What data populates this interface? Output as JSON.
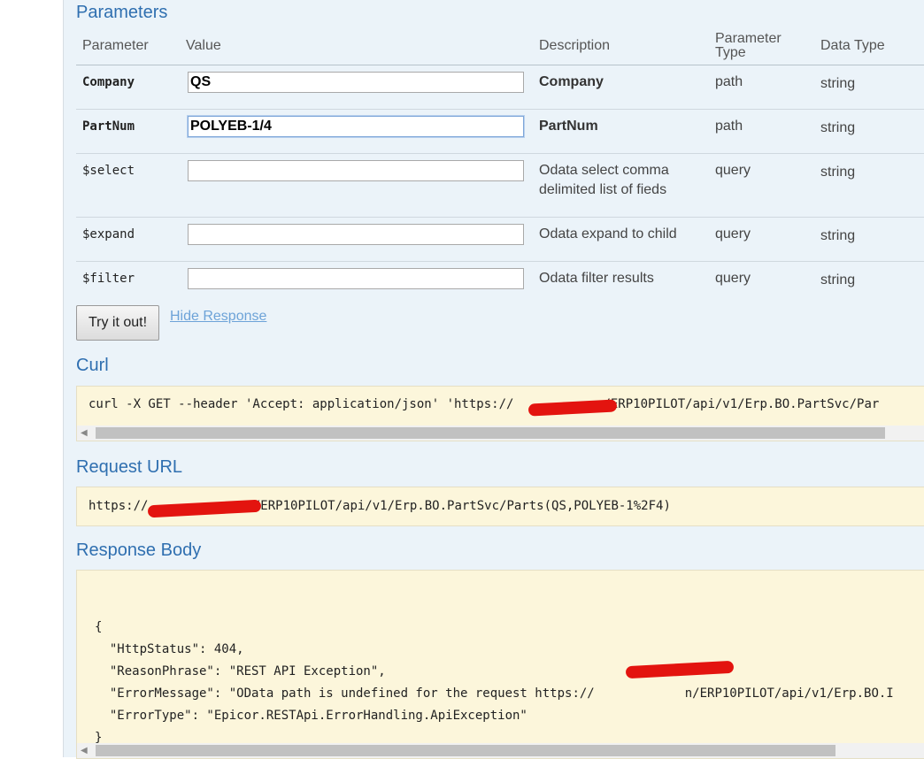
{
  "parameters": {
    "title": "Parameters",
    "headers": {
      "parameter": "Parameter",
      "value": "Value",
      "description": "Description",
      "parameter_type": "Parameter Type",
      "data_type": "Data Type"
    },
    "rows": [
      {
        "name": "Company",
        "value": "QS",
        "description": "Company",
        "param_type": "path",
        "data_type": "string"
      },
      {
        "name": "PartNum",
        "value": "POLYEB-1/4",
        "description": "PartNum",
        "param_type": "path",
        "data_type": "string"
      },
      {
        "name": "$select",
        "value": "",
        "description": "Odata select comma delimited list of fieds",
        "param_type": "query",
        "data_type": "string"
      },
      {
        "name": "$expand",
        "value": "",
        "description": "Odata expand to child",
        "param_type": "query",
        "data_type": "string"
      },
      {
        "name": "$filter",
        "value": "",
        "description": "Odata filter results",
        "param_type": "query",
        "data_type": "string"
      }
    ]
  },
  "actions": {
    "try_label": "Try it out!",
    "hide_response_label": "Hide Response"
  },
  "curl": {
    "title": "Curl",
    "text_before": "curl -X GET --header 'Accept: application/json' 'https://",
    "text_after": "/ERP10PILOT/api/v1/Erp.BO.PartSvc/Par"
  },
  "request_url": {
    "title": "Request URL",
    "text_before": "https://",
    "text_after": "n/ERP10PILOT/api/v1/Erp.BO.PartSvc/Parts(QS,POLYEB-1%2F4)"
  },
  "response_body": {
    "title": "Response Body",
    "lines": [
      "{",
      "  \"HttpStatus\": 404,",
      "  \"ReasonPhrase\": \"REST API Exception\",",
      "  \"ErrorMessage\": \"OData path is undefined for the request https://",
      "  \"ErrorType\": \"Epicor.RESTApi.ErrorHandling.ApiException\"",
      "}"
    ],
    "error_message_tail": "n/ERP10PILOT/api/v1/Erp.BO.I"
  },
  "colors": {
    "panel_bg": "#ebf3f9",
    "title_blue": "#2f6fb0",
    "code_bg": "#fcf6db",
    "redaction": "#e3140f"
  }
}
